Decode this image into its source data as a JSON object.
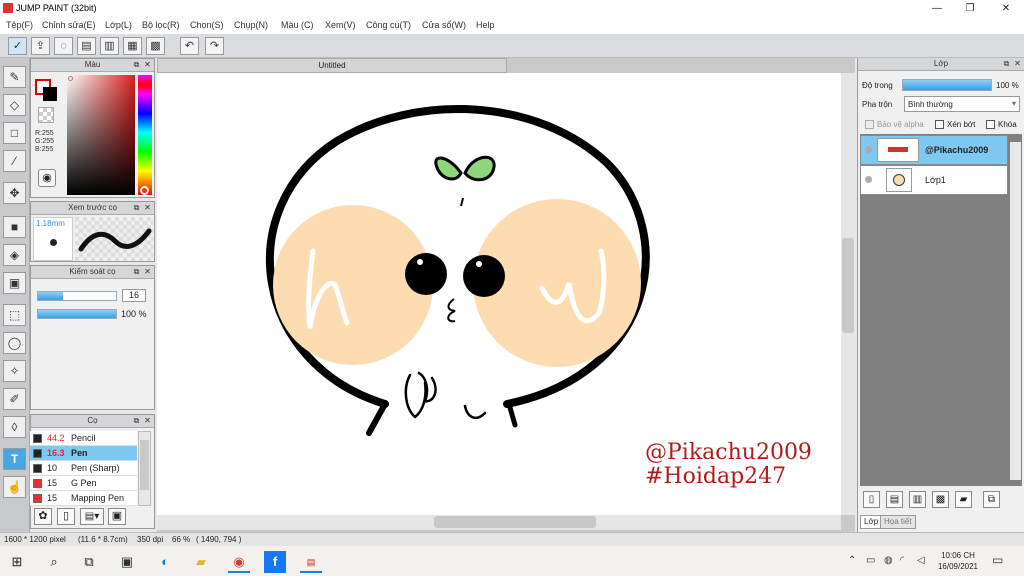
{
  "window": {
    "title": "JUMP PAINT (32bit)",
    "min": "—",
    "max": "❐",
    "close": "✕"
  },
  "menu": [
    "Tệp(F)",
    "Chỉnh sửa(E)",
    "Lớp(L)",
    "Bộ lọc(R)",
    "Chọn(S)",
    "Chụp(N)",
    "Màu (C)",
    "Xem(V)",
    "Công cụ(T)",
    "Cửa sổ(W)",
    "Help"
  ],
  "color_panel": {
    "title": "Màu",
    "r": "R:255",
    "g": "G:255",
    "b": "B:255"
  },
  "preview_panel": {
    "title": "Xem trước cọ",
    "size": "1.18mm"
  },
  "control_panel": {
    "title": "Kiểm soát cọ",
    "size_value": "16",
    "opacity_value": "100 %"
  },
  "brush_panel": {
    "title": "Cọ",
    "brushes": [
      {
        "size": "44.2",
        "name": "Pencil",
        "color": "#222222"
      },
      {
        "size": "16.3",
        "name": "Pen",
        "color": "#222222",
        "selected": true
      },
      {
        "size": "10",
        "name": "Pen (Sharp)",
        "color": "#222222"
      },
      {
        "size": "15",
        "name": "G Pen",
        "color": "#e53030"
      },
      {
        "size": "15",
        "name": "Mapping Pen",
        "color": "#e53030"
      }
    ]
  },
  "document": {
    "tab": "Untitled"
  },
  "artwork": {
    "watermark_1": "@Pikachu2009",
    "watermark_2": "#Hoidap247",
    "watermark_color": "#b21a1a",
    "cheek_color": "#fcdcb0",
    "sprout_color": "#8fd67a"
  },
  "layer_panel": {
    "title": "Lớp",
    "opacity_label": "Độ trong",
    "opacity_value": "100 %",
    "blend_label": "Pha trộn",
    "blend_value": "Bình thường",
    "protect_alpha": "Bảo vệ alpha",
    "clip": "Xén bớt",
    "lock": "Khóa",
    "layers": [
      {
        "name": "@Pikachu2009",
        "selected": true
      },
      {
        "name": "Lớp1",
        "selected": false
      }
    ],
    "tab_layer": "Lớp",
    "tab_texture": "Họa tiết"
  },
  "status": {
    "size": "1600 * 1200 pixel",
    "physical": "(11.6 * 8.7cm)",
    "dpi": "350 dpi",
    "zoom": "66 %",
    "coords": "( 1490, 794 )"
  },
  "taskbar": {
    "time": "10:06 CH",
    "date": "16/09/2021"
  },
  "accent": "#48a5e0"
}
